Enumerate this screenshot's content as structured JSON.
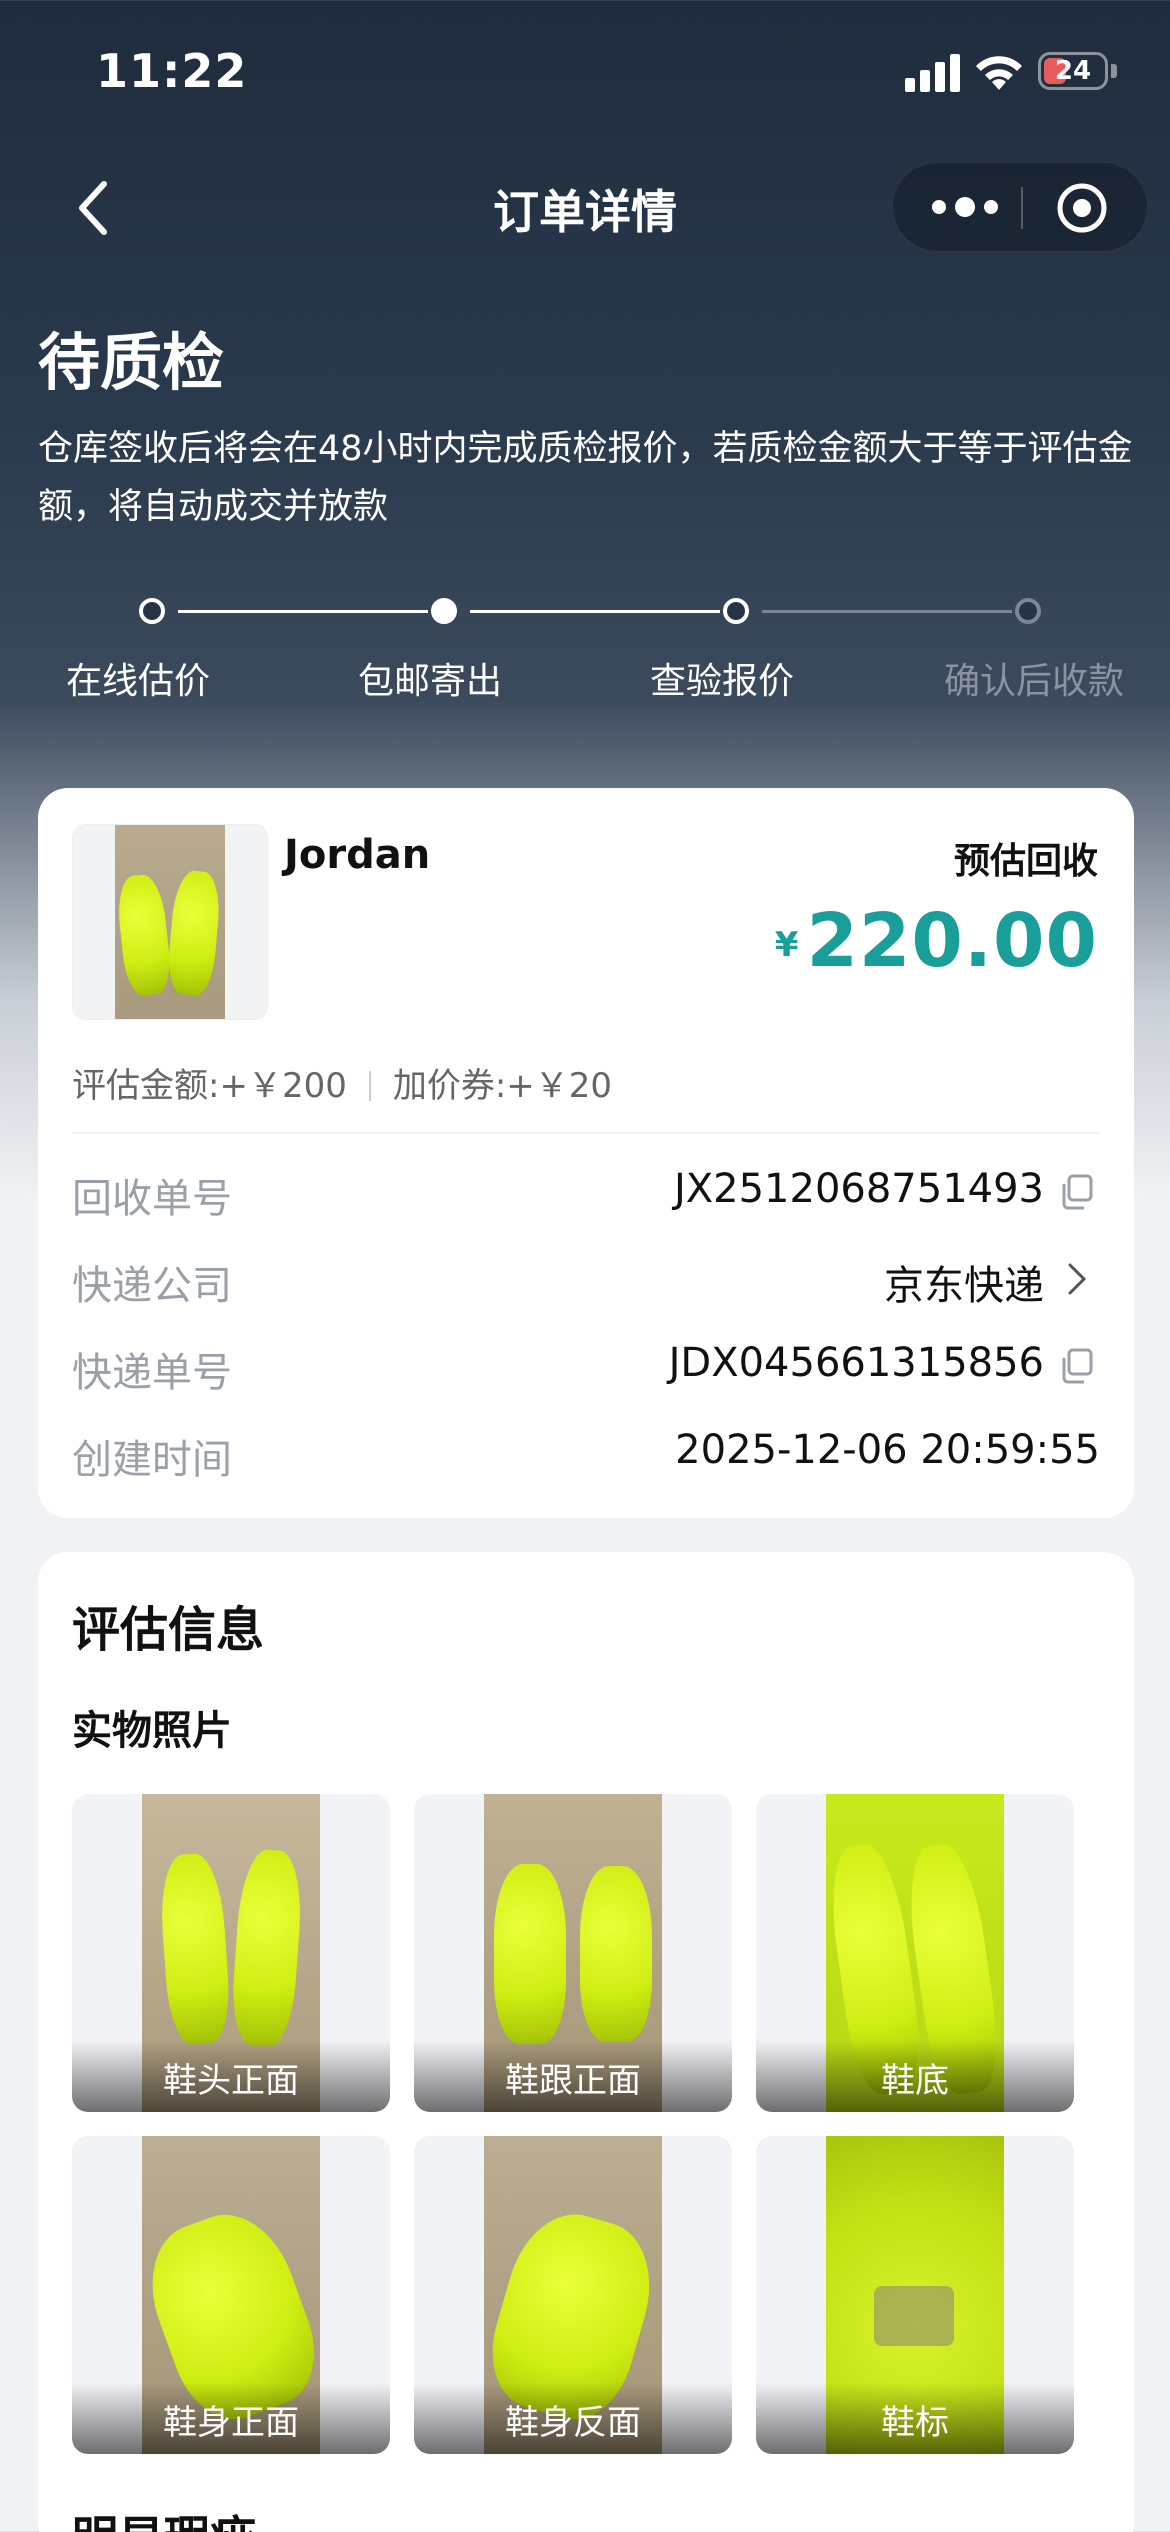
{
  "status_bar": {
    "time": "11:22",
    "battery": "24"
  },
  "nav": {
    "title": "订单详情"
  },
  "status": {
    "title": "待质检",
    "description": "仓库签收后将会在48小时内完成质检报价，若质检金额大于等于评估金额，将自动成交并放款"
  },
  "steps": [
    {
      "label": "在线估价",
      "state": "done"
    },
    {
      "label": "包邮寄出",
      "state": "active"
    },
    {
      "label": "查验报价",
      "state": "pending"
    },
    {
      "label": "确认后收款",
      "state": "inactive"
    }
  ],
  "product": {
    "name": "Jordan",
    "estimate_label": "预估回收",
    "currency": "¥",
    "price": "220.00",
    "eval_amount": "评估金额:+￥200",
    "coupon": "加价券:+￥20"
  },
  "order": {
    "recycle_no_label": "回收单号",
    "recycle_no": "JX2512068751493",
    "courier_label": "快递公司",
    "courier": "京东快递",
    "tracking_label": "快递单号",
    "tracking": "JDX045661315856",
    "created_label": "创建时间",
    "created": "2025-12-06 20:59:55"
  },
  "evaluation": {
    "title": "评估信息",
    "photos_title": "实物照片",
    "photos": [
      "鞋头正面",
      "鞋跟正面",
      "鞋底",
      "鞋身正面",
      "鞋身反面",
      "鞋标"
    ],
    "next_section": "明显瑕疵"
  },
  "colors": {
    "accent": "#1a9e9a",
    "header_bg": "#1f2c3d"
  }
}
